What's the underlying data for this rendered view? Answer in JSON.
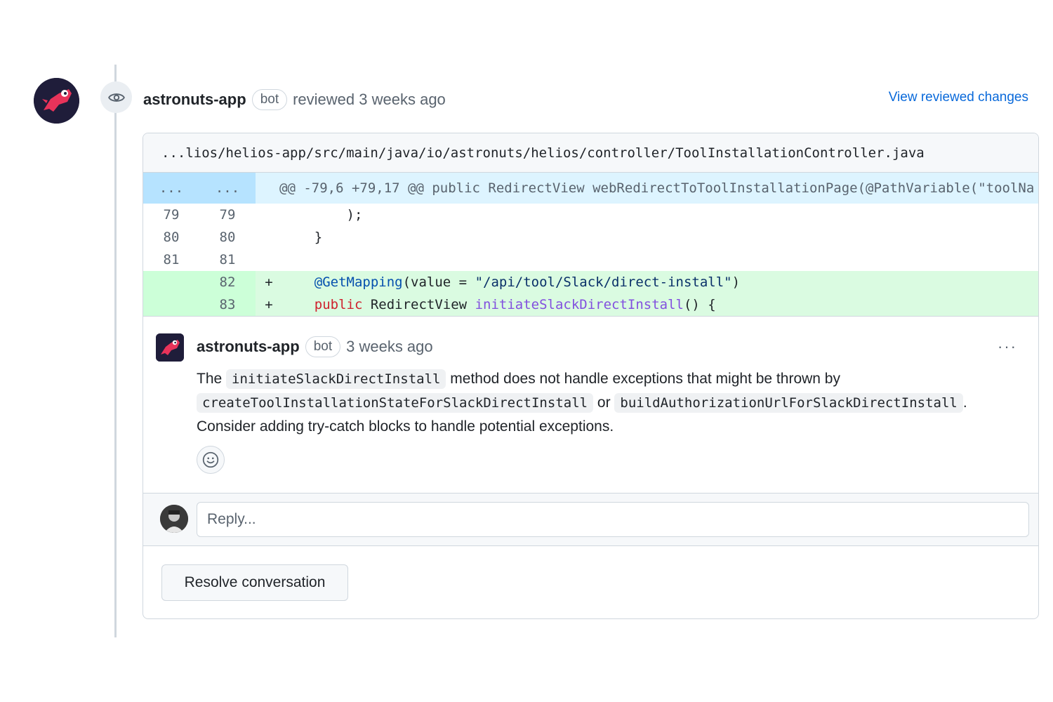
{
  "review": {
    "author": "astronuts-app",
    "badge": "bot",
    "meta": "reviewed 3 weeks ago",
    "view_changes": "View reviewed changes"
  },
  "file": {
    "path": "...lios/helios-app/src/main/java/io/astronuts/helios/controller/ToolInstallationController.java"
  },
  "diff": {
    "hunk": {
      "old_ln": "...",
      "new_ln": "...",
      "text": "@@ -79,6 +79,17 @@ public RedirectView webRedirectToToolInstallationPage(@PathVariable(\"toolNa"
    },
    "lines": [
      {
        "old": "79",
        "new": "79",
        "sign": "",
        "code": "        );"
      },
      {
        "old": "80",
        "new": "80",
        "sign": "",
        "code": "    }"
      },
      {
        "old": "81",
        "new": "81",
        "sign": "",
        "code": ""
      }
    ],
    "added": [
      {
        "new": "82",
        "sign": "+",
        "ann": "@GetMapping",
        "rest1": "(value = ",
        "str": "\"/api/tool/Slack/direct-install\"",
        "rest2": ")"
      },
      {
        "new": "83",
        "sign": "+",
        "kw": "public",
        "type": " RedirectView ",
        "fn": "initiateSlackDirectInstall",
        "rest": "() {"
      }
    ]
  },
  "comment": {
    "author": "astronuts-app",
    "badge": "bot",
    "time": "3 weeks ago",
    "more": "···",
    "body_1": "The ",
    "code_1": "initiateSlackDirectInstall",
    "body_2": " method does not handle exceptions that might be thrown by",
    "code_2": "createToolInstallationStateForSlackDirectInstall",
    "body_3": " or ",
    "code_3": "buildAuthorizationUrlForSlackDirectInstall",
    "body_4": ".",
    "body_5": "Consider adding try-catch blocks to handle potential exceptions."
  },
  "reply": {
    "placeholder": "Reply..."
  },
  "actions": {
    "resolve": "Resolve conversation"
  },
  "icons": {
    "eye": "eye-icon",
    "smiley": "smiley-icon",
    "avatar_bot": "astronuts-logo",
    "avatar_user": "user-avatar"
  }
}
